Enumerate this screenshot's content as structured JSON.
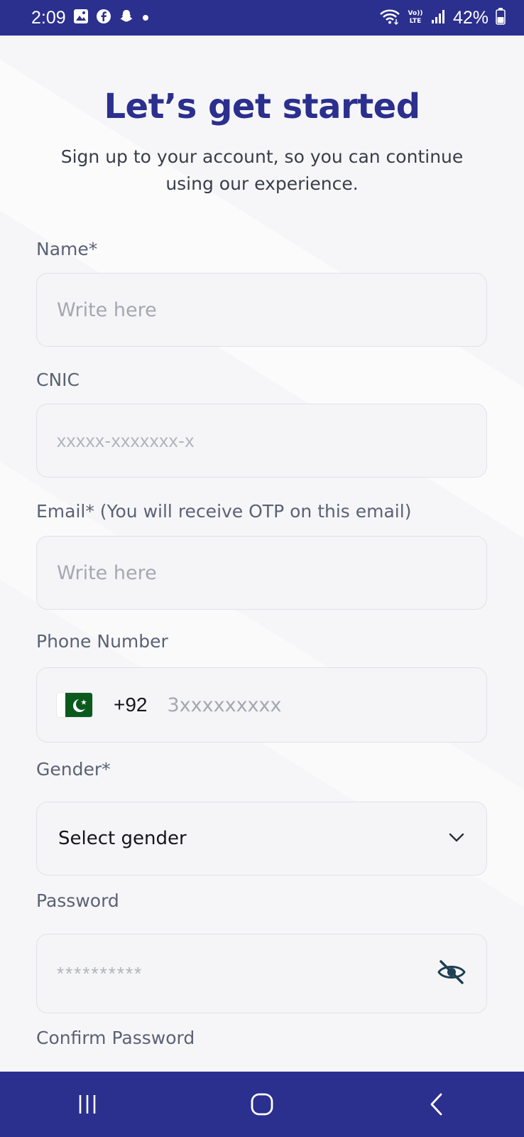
{
  "status_bar": {
    "time": "2:09",
    "battery": "42%",
    "icons": [
      "gallery-icon",
      "facebook-icon",
      "snapchat-icon",
      "dot-icon",
      "wifi-icon",
      "volte-icon",
      "signal-icon",
      "battery-icon"
    ]
  },
  "header": {
    "title": "Let’s get started",
    "subtitle": "Sign up to your account, so you can continue using our experience."
  },
  "form": {
    "name": {
      "label": "Name*",
      "placeholder": "Write here"
    },
    "cnic": {
      "label": "CNIC",
      "placeholder": "xxxxx-xxxxxxx-x"
    },
    "email": {
      "label": "Email* (You will receive OTP on this email)",
      "placeholder": "Write here"
    },
    "phone": {
      "label": "Phone Number",
      "country_code": "+92",
      "placeholder": "3xxxxxxxxx"
    },
    "gender": {
      "label": "Gender*",
      "selected": "Select gender"
    },
    "password": {
      "label": "Password",
      "placeholder": "**********"
    },
    "confirm_password": {
      "label": "Confirm Password"
    }
  },
  "colors": {
    "brand": "#2b2f8e",
    "label": "#5a6275",
    "placeholder": "#a5a8b1",
    "field_bg": "#f5f5f7",
    "field_border": "#e1e2e7",
    "flag_green": "#0b5a1d"
  }
}
